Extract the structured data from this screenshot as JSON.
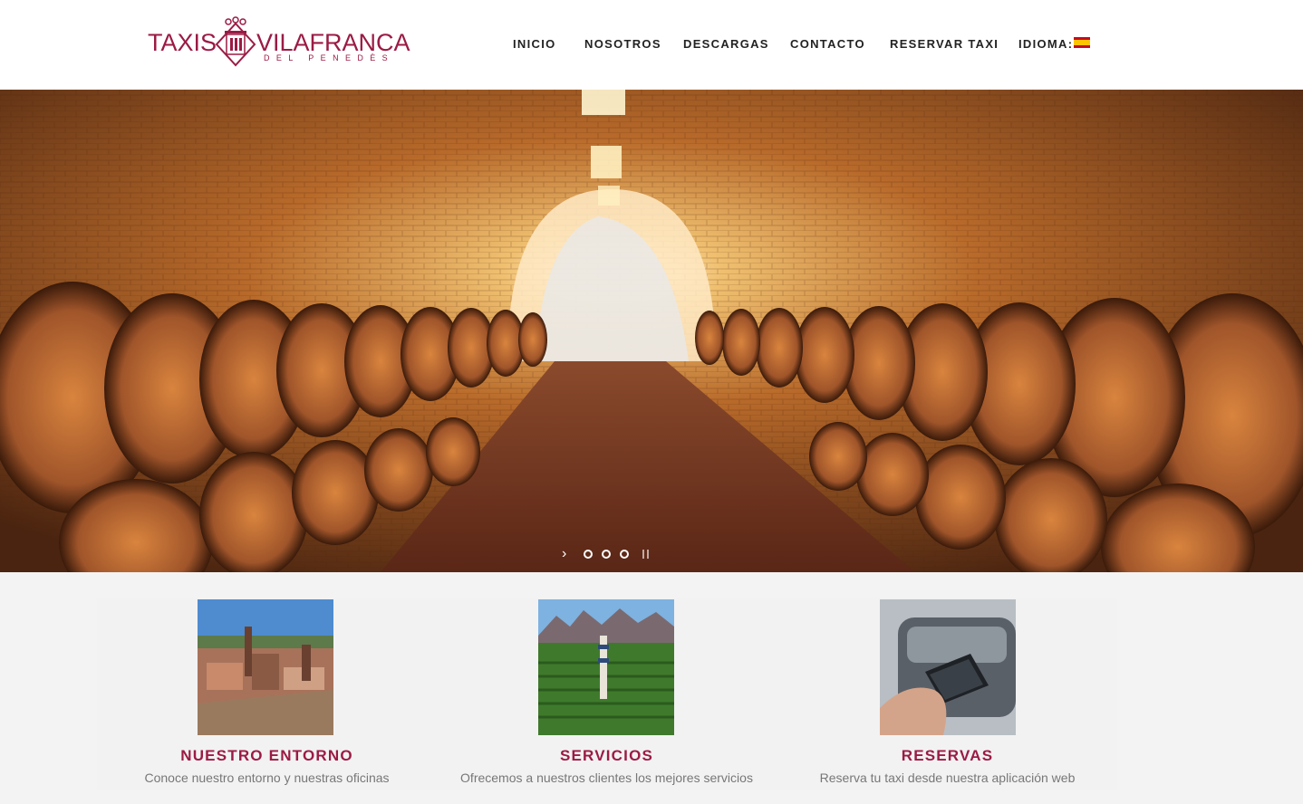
{
  "brand": {
    "left_word": "TAXIS",
    "right_word": "VILAFRANCA",
    "subtitle": "DEL PENEDÈS",
    "color": "#9b1b44"
  },
  "nav": {
    "items": [
      {
        "label": "INICIO"
      },
      {
        "label": "NOSOTROS"
      },
      {
        "label": "DESCARGAS"
      },
      {
        "label": "CONTACTO"
      },
      {
        "label": "RESERVAR TAXI"
      },
      {
        "label": "IDIOMA:"
      }
    ],
    "language_flag": "spain-flag-icon"
  },
  "hero": {
    "image": "wine-cellar-barrels-image",
    "slider": {
      "prev_icon": "chevron-right-icon",
      "dots": 3,
      "pause_icon": "pause-icon"
    }
  },
  "features": [
    {
      "title": "NUESTRO ENTORNO",
      "description": "Conoce nuestro entorno y nuestras oficinas",
      "image": "town-aerial-image"
    },
    {
      "title": "SERVICIOS",
      "description": "Ofrecemos a nuestros clientes los mejores servicios",
      "image": "vineyard-mountains-image"
    },
    {
      "title": "RESERVAS",
      "description": "Reserva tu taxi desde nuestra aplicación web",
      "image": "phone-in-hand-image"
    }
  ],
  "colors": {
    "accent": "#9b1b44",
    "nav_text": "#222222",
    "desc_text": "#777777",
    "section_bg": "#f3f3f3"
  }
}
